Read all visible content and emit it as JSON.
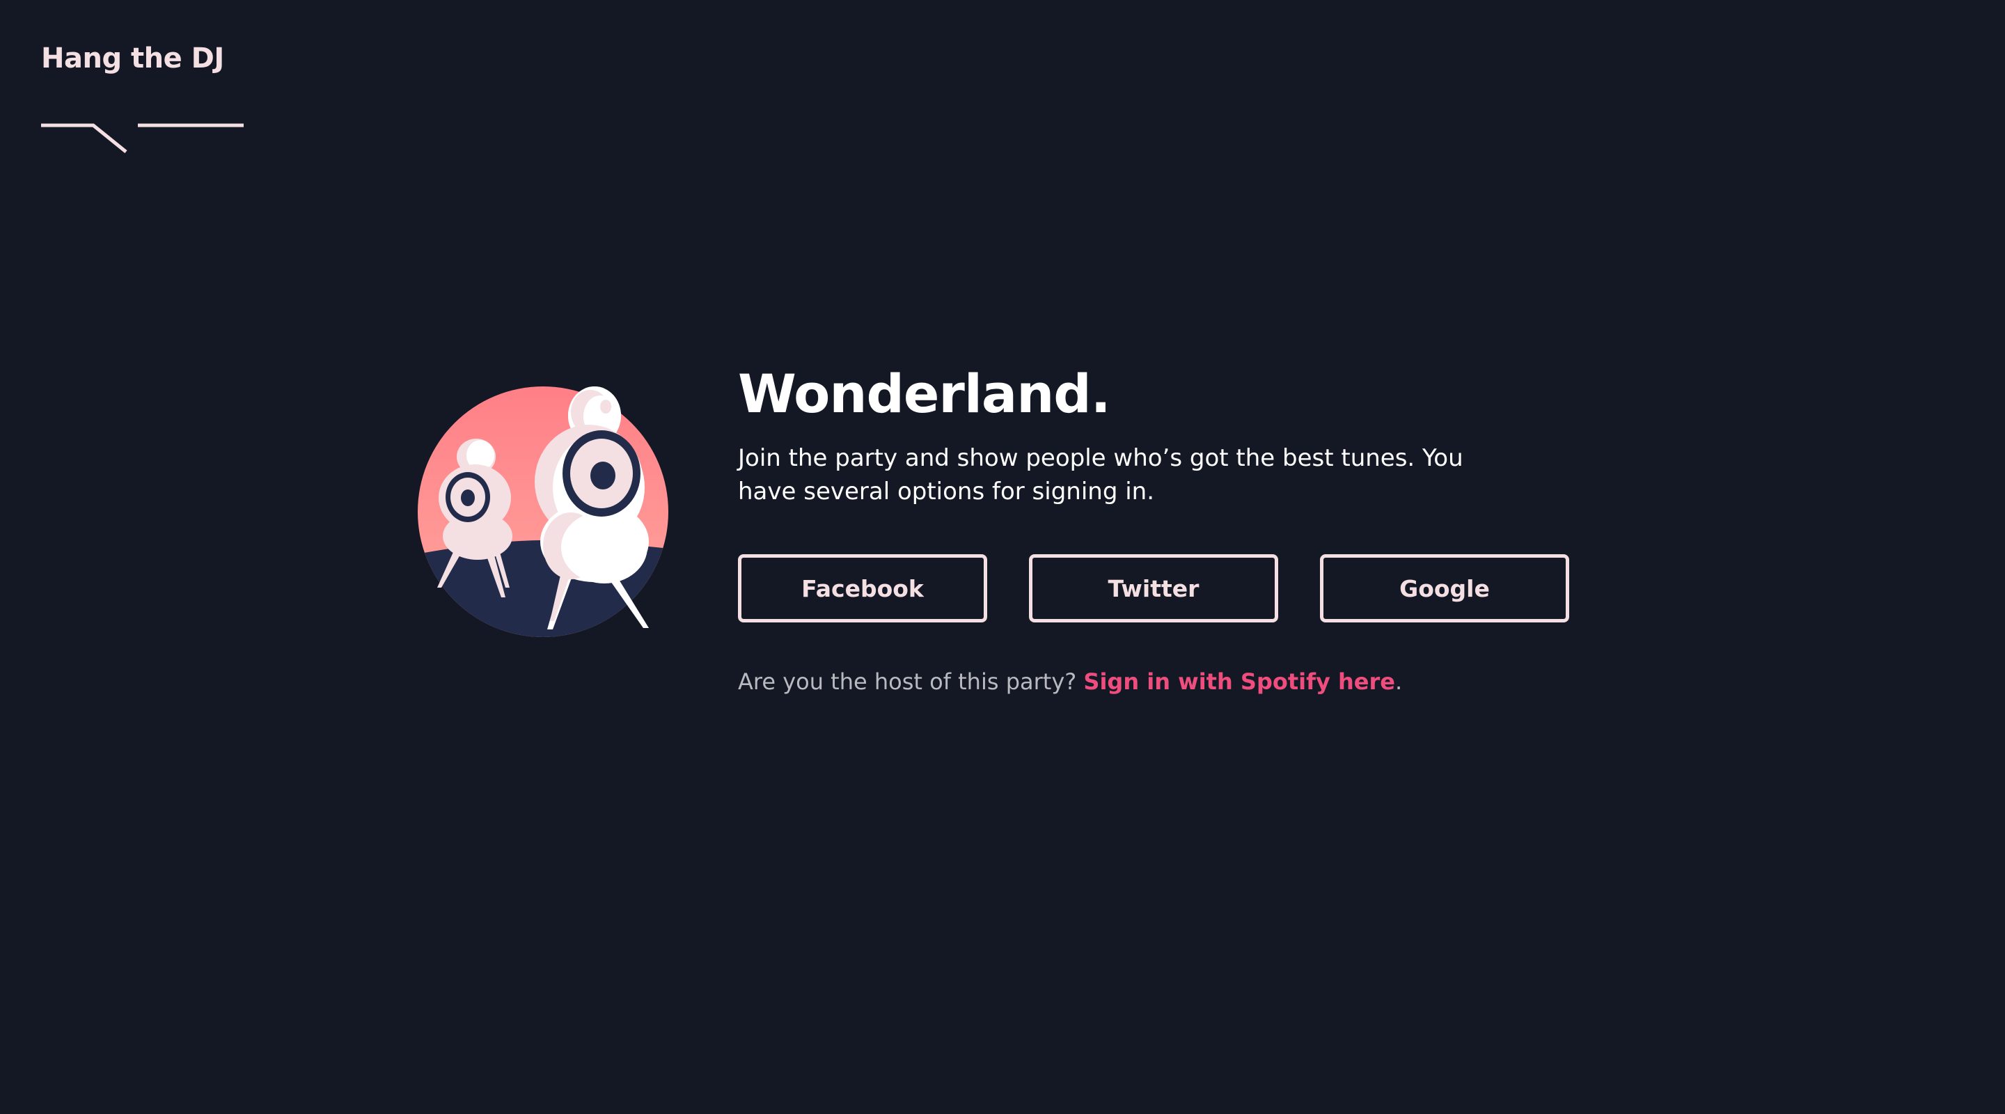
{
  "brand": {
    "name": "Hang the DJ",
    "accent_color": "#ee4d7e",
    "text_color": "#f4dfe2",
    "background_color": "#131824"
  },
  "hero": {
    "illustration": "speakers-illustration",
    "title": "Wonderland.",
    "subtitle": "Join the party and show people who’s got the best tunes. You have several options for signing in."
  },
  "login_buttons": [
    {
      "label": "Facebook"
    },
    {
      "label": "Twitter"
    },
    {
      "label": "Google"
    }
  ],
  "host_prompt": {
    "question": "Are you the host of this party? ",
    "link_label": "Sign in with Spotify here",
    "trailing": "."
  }
}
